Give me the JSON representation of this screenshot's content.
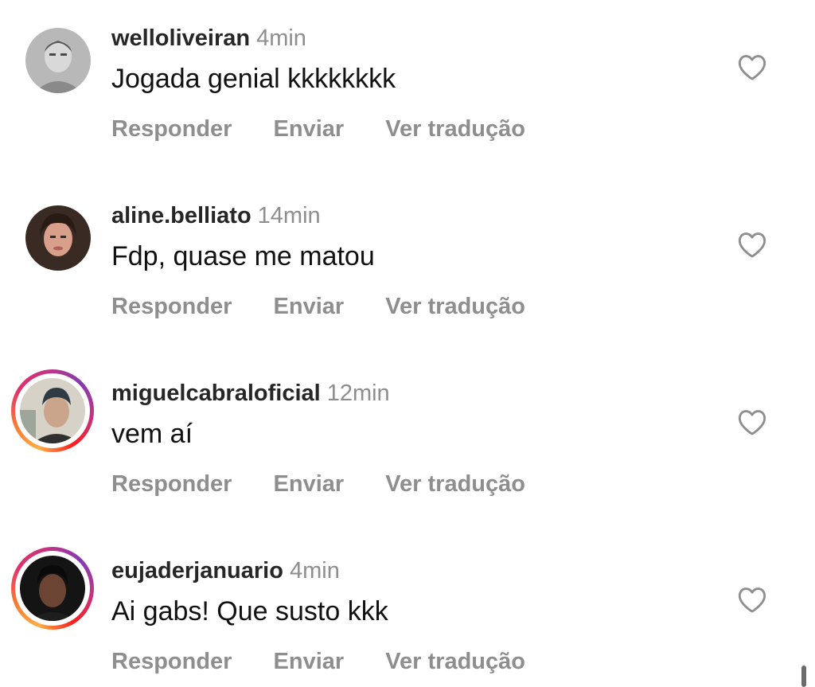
{
  "comments": [
    {
      "username": "welloliveiran",
      "time": "4min",
      "text": "Jogada genial kkkkkkkk",
      "reply_label": "Responder",
      "send_label": "Enviar",
      "translate_label": "Ver tradução",
      "has_story_ring": false
    },
    {
      "username": "aline.belliato",
      "time": "14min",
      "text": "Fdp, quase me matou",
      "reply_label": "Responder",
      "send_label": "Enviar",
      "translate_label": "Ver tradução",
      "has_story_ring": false
    },
    {
      "username": "miguelcabraloficial",
      "time": "12min",
      "text": "vem aí",
      "reply_label": "Responder",
      "send_label": "Enviar",
      "translate_label": "Ver tradução",
      "has_story_ring": true
    },
    {
      "username": "eujaderjanuario",
      "time": "4min",
      "text": "Ai gabs! Que susto kkk",
      "reply_label": "Responder",
      "send_label": "Enviar",
      "translate_label": "Ver tradução",
      "has_story_ring": true
    }
  ],
  "icons": {
    "like": "heart-outline-icon"
  },
  "colors": {
    "username": "#262626",
    "secondary": "#8e8e8e",
    "text": "#111111",
    "story_ring_start": "#fcaf45",
    "story_ring_end": "#c13584"
  }
}
